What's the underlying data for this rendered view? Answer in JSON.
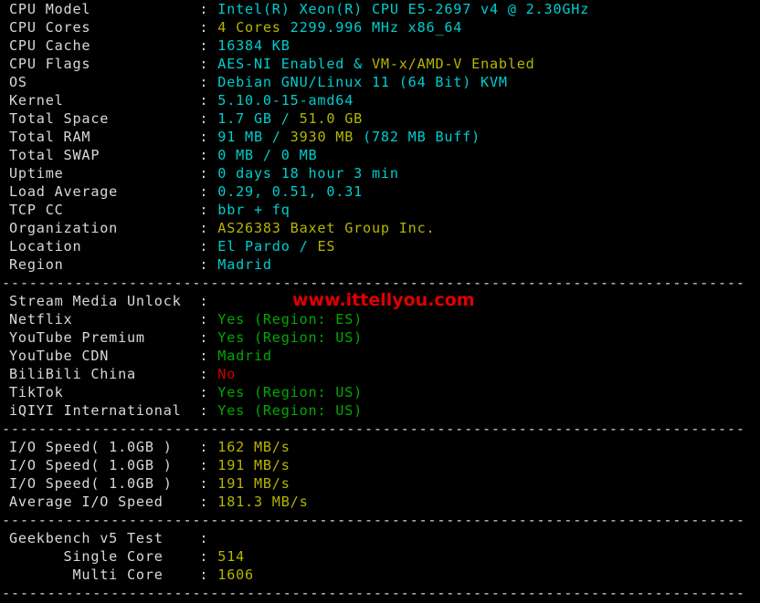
{
  "terminal": {
    "background": "#000000",
    "label_color": "#d8d8d8",
    "cyan": "#00cdcd",
    "yellow": "#b5b500",
    "green": "#00a800",
    "red": "#cd0000",
    "separator": "----------------------------------------------------------------------------------"
  },
  "watermark": {
    "text": "www.ittellyou.com",
    "color": "#e00000"
  },
  "system": {
    "rows": [
      {
        "label": "CPU Model",
        "colon": ":",
        "v1": "Intel(R) Xeon(R) CPU E5-2697 v4 @ 2.30GHz",
        "c1": "cyan",
        "v2": "",
        "c2": "",
        "v3": "",
        "c3": ""
      },
      {
        "label": "CPU Cores",
        "colon": ":",
        "v1": "4 Cores ",
        "c1": "yellow",
        "v2": "2299.996 MHz x86_64",
        "c2": "cyan",
        "v3": "",
        "c3": ""
      },
      {
        "label": "CPU Cache",
        "colon": ":",
        "v1": "16384 KB",
        "c1": "cyan",
        "v2": "",
        "c2": "",
        "v3": "",
        "c3": ""
      },
      {
        "label": "CPU Flags",
        "colon": ":",
        "v1": "AES-NI Enabled & ",
        "c1": "cyan",
        "v2": "VM-x/AMD-V Enabled",
        "c2": "yellow",
        "v3": "",
        "c3": ""
      },
      {
        "label": "OS",
        "colon": ":",
        "v1": "Debian GNU/Linux 11 (64 Bit) KVM",
        "c1": "cyan",
        "v2": "",
        "c2": "",
        "v3": "",
        "c3": ""
      },
      {
        "label": "Kernel",
        "colon": ":",
        "v1": "5.10.0-15-amd64",
        "c1": "cyan",
        "v2": "",
        "c2": "",
        "v3": "",
        "c3": ""
      },
      {
        "label": "Total Space",
        "colon": ":",
        "v1": "1.7 GB / ",
        "c1": "cyan",
        "v2": "51.0 GB",
        "c2": "yellow",
        "v3": "",
        "c3": ""
      },
      {
        "label": "Total RAM",
        "colon": ":",
        "v1": "91 MB / ",
        "c1": "cyan",
        "v2": "3930 MB",
        "c2": "yellow",
        "v3": " (782 MB Buff)",
        "c3": "cyan"
      },
      {
        "label": "Total SWAP",
        "colon": ":",
        "v1": "0 MB / 0 MB",
        "c1": "cyan",
        "v2": "",
        "c2": "",
        "v3": "",
        "c3": ""
      },
      {
        "label": "Uptime",
        "colon": ":",
        "v1": "0 days 18 hour 3 min",
        "c1": "cyan",
        "v2": "",
        "c2": "",
        "v3": "",
        "c3": ""
      },
      {
        "label": "Load Average",
        "colon": ":",
        "v1": "0.29, 0.51, 0.31",
        "c1": "cyan",
        "v2": "",
        "c2": "",
        "v3": "",
        "c3": ""
      },
      {
        "label": "TCP CC",
        "colon": ":",
        "v1": "bbr + fq",
        "c1": "cyan",
        "v2": "",
        "c2": "",
        "v3": "",
        "c3": ""
      },
      {
        "label": "Organization",
        "colon": ":",
        "v1": "AS26383 Baxet Group Inc.",
        "c1": "yellow",
        "v2": "",
        "c2": "",
        "v3": "",
        "c3": ""
      },
      {
        "label": "Location",
        "colon": ":",
        "v1": "El Pardo / ",
        "c1": "cyan",
        "v2": "ES",
        "c2": "yellow",
        "v3": "",
        "c3": ""
      },
      {
        "label": "Region",
        "colon": ":",
        "v1": "Madrid",
        "c1": "cyan",
        "v2": "",
        "c2": "",
        "v3": "",
        "c3": ""
      }
    ]
  },
  "stream_media": {
    "rows": [
      {
        "label": "Stream Media Unlock",
        "colon": ":",
        "v1": "",
        "c1": "green",
        "v2": "",
        "c2": "",
        "v3": "",
        "c3": ""
      },
      {
        "label": "Netflix",
        "colon": ":",
        "v1": "Yes (Region: ES)",
        "c1": "green",
        "v2": "",
        "c2": "",
        "v3": "",
        "c3": ""
      },
      {
        "label": "YouTube Premium",
        "colon": ":",
        "v1": "Yes (Region: US)",
        "c1": "green",
        "v2": "",
        "c2": "",
        "v3": "",
        "c3": ""
      },
      {
        "label": "YouTube CDN",
        "colon": ":",
        "v1": "Madrid",
        "c1": "green",
        "v2": "",
        "c2": "",
        "v3": "",
        "c3": ""
      },
      {
        "label": "BiliBili China",
        "colon": ":",
        "v1": "No",
        "c1": "red",
        "v2": "",
        "c2": "",
        "v3": "",
        "c3": ""
      },
      {
        "label": "TikTok",
        "colon": ":",
        "v1": "Yes (Region: US)",
        "c1": "green",
        "v2": "",
        "c2": "",
        "v3": "",
        "c3": ""
      },
      {
        "label": "iQIYI International",
        "colon": ":",
        "v1": "Yes (Region: US)",
        "c1": "green",
        "v2": "",
        "c2": "",
        "v3": "",
        "c3": ""
      }
    ]
  },
  "io_speed": {
    "rows": [
      {
        "label": "I/O Speed( 1.0GB )",
        "colon": ":",
        "v1": "162 MB/s",
        "c1": "yellow",
        "v2": "",
        "c2": "",
        "v3": "",
        "c3": ""
      },
      {
        "label": "I/O Speed( 1.0GB )",
        "colon": ":",
        "v1": "191 MB/s",
        "c1": "yellow",
        "v2": "",
        "c2": "",
        "v3": "",
        "c3": ""
      },
      {
        "label": "I/O Speed( 1.0GB )",
        "colon": ":",
        "v1": "191 MB/s",
        "c1": "yellow",
        "v2": "",
        "c2": "",
        "v3": "",
        "c3": ""
      },
      {
        "label": "Average I/O Speed",
        "colon": ":",
        "v1": "181.3 MB/s",
        "c1": "yellow",
        "v2": "",
        "c2": "",
        "v3": "",
        "c3": ""
      }
    ]
  },
  "geekbench": {
    "rows": [
      {
        "label": "Geekbench v5 Test",
        "colon": ":",
        "v1": "",
        "c1": "yellow",
        "v2": "",
        "c2": "",
        "v3": "",
        "c3": ""
      },
      {
        "label": "      Single Core",
        "colon": ":",
        "v1": "514",
        "c1": "yellow",
        "v2": "",
        "c2": "",
        "v3": "",
        "c3": ""
      },
      {
        "label": "       Multi Core",
        "colon": ":",
        "v1": "1606",
        "c1": "yellow",
        "v2": "",
        "c2": "",
        "v3": "",
        "c3": ""
      }
    ]
  }
}
